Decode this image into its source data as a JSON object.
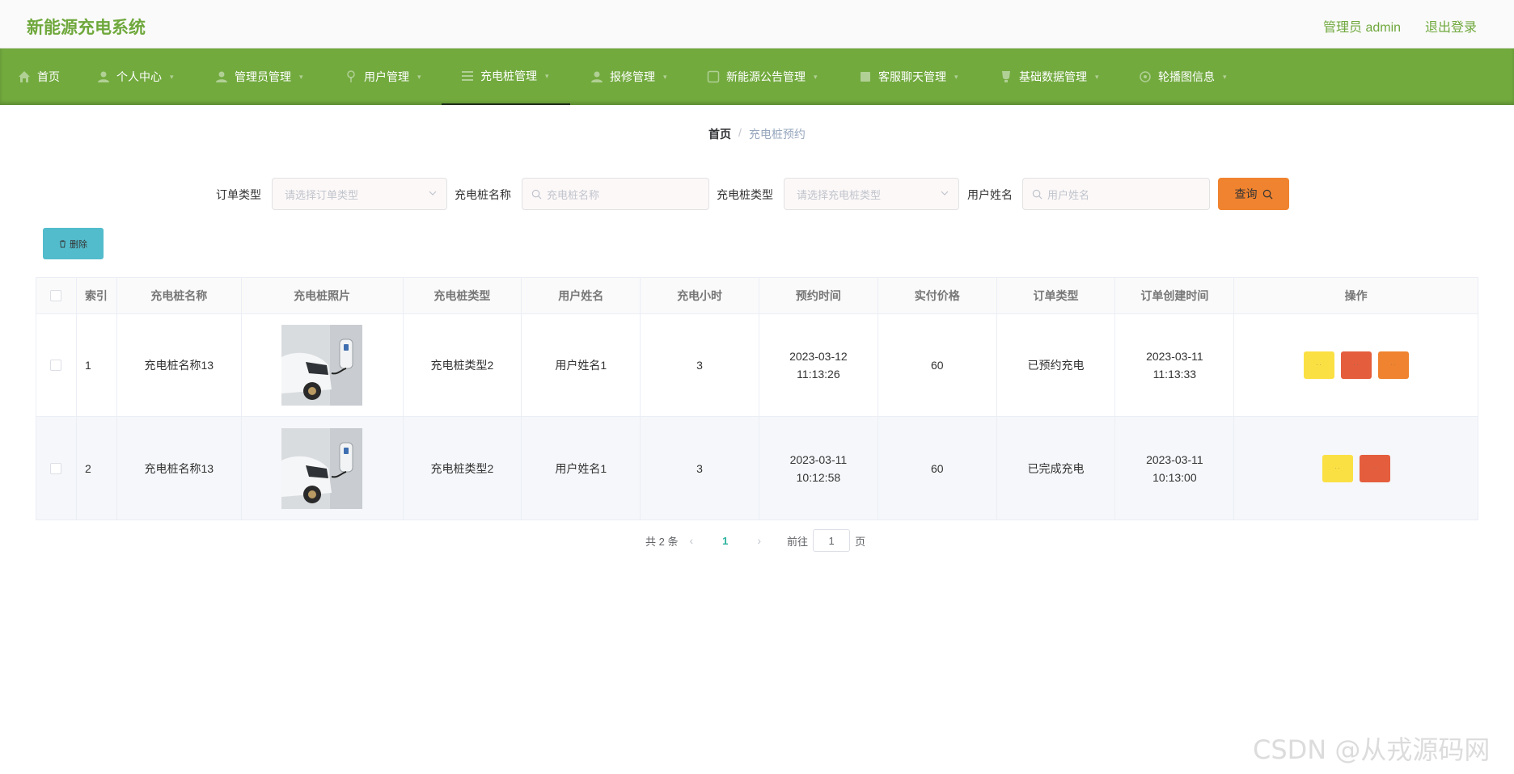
{
  "header": {
    "brand": "新能源充电系统",
    "user": "管理员 admin",
    "logout": "退出登录"
  },
  "nav": {
    "items": [
      {
        "label": "首页",
        "icon": "home-icon"
      },
      {
        "label": "个人中心",
        "icon": "user-icon"
      },
      {
        "label": "管理员管理",
        "icon": "user-icon"
      },
      {
        "label": "用户管理",
        "icon": "user-pin-icon"
      },
      {
        "label": "充电桩管理",
        "icon": "list-icon"
      },
      {
        "label": "报修管理",
        "icon": "user-icon"
      },
      {
        "label": "新能源公告管理",
        "icon": "notice-icon"
      },
      {
        "label": "客服聊天管理",
        "icon": "chat-icon"
      },
      {
        "label": "基础数据管理",
        "icon": "cup-icon"
      },
      {
        "label": "轮播图信息",
        "icon": "gear-icon"
      }
    ],
    "active": "充电桩管理"
  },
  "breadcrumb": {
    "home": "首页",
    "sep": "/",
    "current": "充电桩预约"
  },
  "search": {
    "order_type_label": "订单类型",
    "order_type_placeholder": "请选择订单类型",
    "pile_name_label": "充电桩名称",
    "pile_name_placeholder": "充电桩名称",
    "pile_type_label": "充电桩类型",
    "pile_type_placeholder": "请选择充电桩类型",
    "user_name_label": "用户姓名",
    "user_name_placeholder": "用户姓名",
    "query_label": "查询"
  },
  "toolbar": {
    "delete_label": "删除"
  },
  "table": {
    "columns": [
      "索引",
      "充电桩名称",
      "充电桩照片",
      "充电桩类型",
      "用户姓名",
      "充电小时",
      "预约时间",
      "实付价格",
      "订单类型",
      "订单创建时间",
      "操作"
    ],
    "rows": [
      {
        "index": "1",
        "name": "充电桩名称13",
        "type": "充电桩类型2",
        "user": "用户姓名1",
        "hours": "3",
        "reserve_time": "2023-03-12 11:13:26",
        "price": "60",
        "order_type": "已预约充电",
        "created": "2023-03-11 11:13:33"
      },
      {
        "index": "2",
        "name": "充电桩名称13",
        "type": "充电桩类型2",
        "user": "用户姓名1",
        "hours": "3",
        "reserve_time": "2023-03-11 10:12:58",
        "price": "60",
        "order_type": "已完成充电",
        "created": "2023-03-11 10:13:00"
      }
    ]
  },
  "pager": {
    "total": "共 2 条",
    "prev": "‹",
    "current": "1",
    "next": "›",
    "goto": "前往",
    "page_value": "1",
    "page_unit": "页"
  },
  "watermark": "CSDN @从戎源码网",
  "colors": {
    "brand": "#6fa83c",
    "nav": "#72aa3e",
    "query": "#f0832f",
    "delete": "#53bccc",
    "view": "#fbe044",
    "danger": "#e45e3e"
  }
}
